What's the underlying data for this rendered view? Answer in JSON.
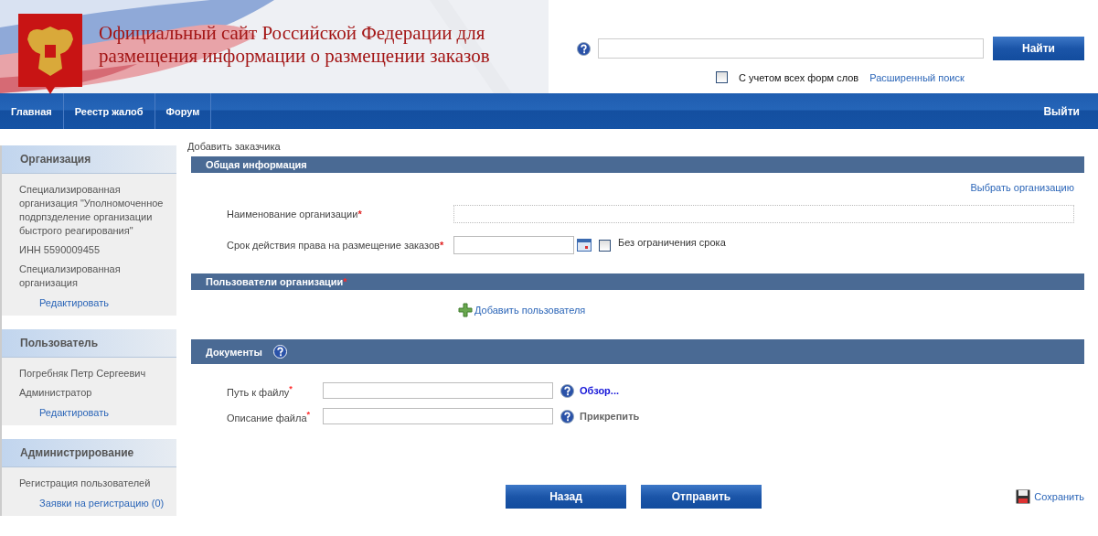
{
  "header": {
    "title_line_1": "Официальный сайт Российской Федерации для",
    "title_line_2": "размещения информации о размещении заказов"
  },
  "search": {
    "button": "Найти",
    "all_forms": {
      "label": "С учетом всех форм слов",
      "checked": false
    },
    "advanced_link": "Расширенный поиск"
  },
  "nav": {
    "items": [
      {
        "label": "Главная",
        "selected": false
      },
      {
        "label": "Реестр жалоб",
        "selected": false
      },
      {
        "label": "Форум",
        "selected": false
      }
    ],
    "logout": "Выйти"
  },
  "sidebar": [
    {
      "title": "Организация",
      "lines": [
        "Специализированная организация \"Уполномоченное подрпзделение организации быстрого реагирования\"",
        "ИНН 5590009455",
        "Специализированная организация"
      ],
      "link": "Редактировать"
    },
    {
      "title": "Пользователь",
      "lines": [
        "Погребняк Петр Сергеевич",
        "Администратор"
      ],
      "link": "Редактировать"
    },
    {
      "title": "Администрирование",
      "lines": [
        "Регистрация пользователей"
      ],
      "link": "Заявки на регистрацию (0)"
    }
  ],
  "breadcrumb": "Добавить заказчика",
  "general": {
    "title": "Общая информация",
    "select_link": "Выбрать организацию",
    "fields": [
      {
        "label": "Наименование организации",
        "required_mark": "*",
        "kind": "text"
      },
      {
        "label": "Срок действия права на размещение заказов",
        "required_mark": "*",
        "kind": "date",
        "no_limit": {
          "label": "Без ограничения срока",
          "checked": false
        }
      }
    ]
  },
  "users": {
    "title": "Пользователи организации",
    "required_mark": "*",
    "add_link": "Добавить пользователя"
  },
  "documents": {
    "title": "Документы",
    "fields": [
      {
        "label": "Путь к файлу",
        "required_mark": "*",
        "action": "Обзор...",
        "disabled": false
      },
      {
        "label": "Описание файла",
        "required_mark": "*",
        "action": "Прикрепить",
        "disabled": true
      }
    ]
  },
  "buttons": [
    "Назад",
    "Отправить"
  ],
  "save_link": "Сохранить"
}
